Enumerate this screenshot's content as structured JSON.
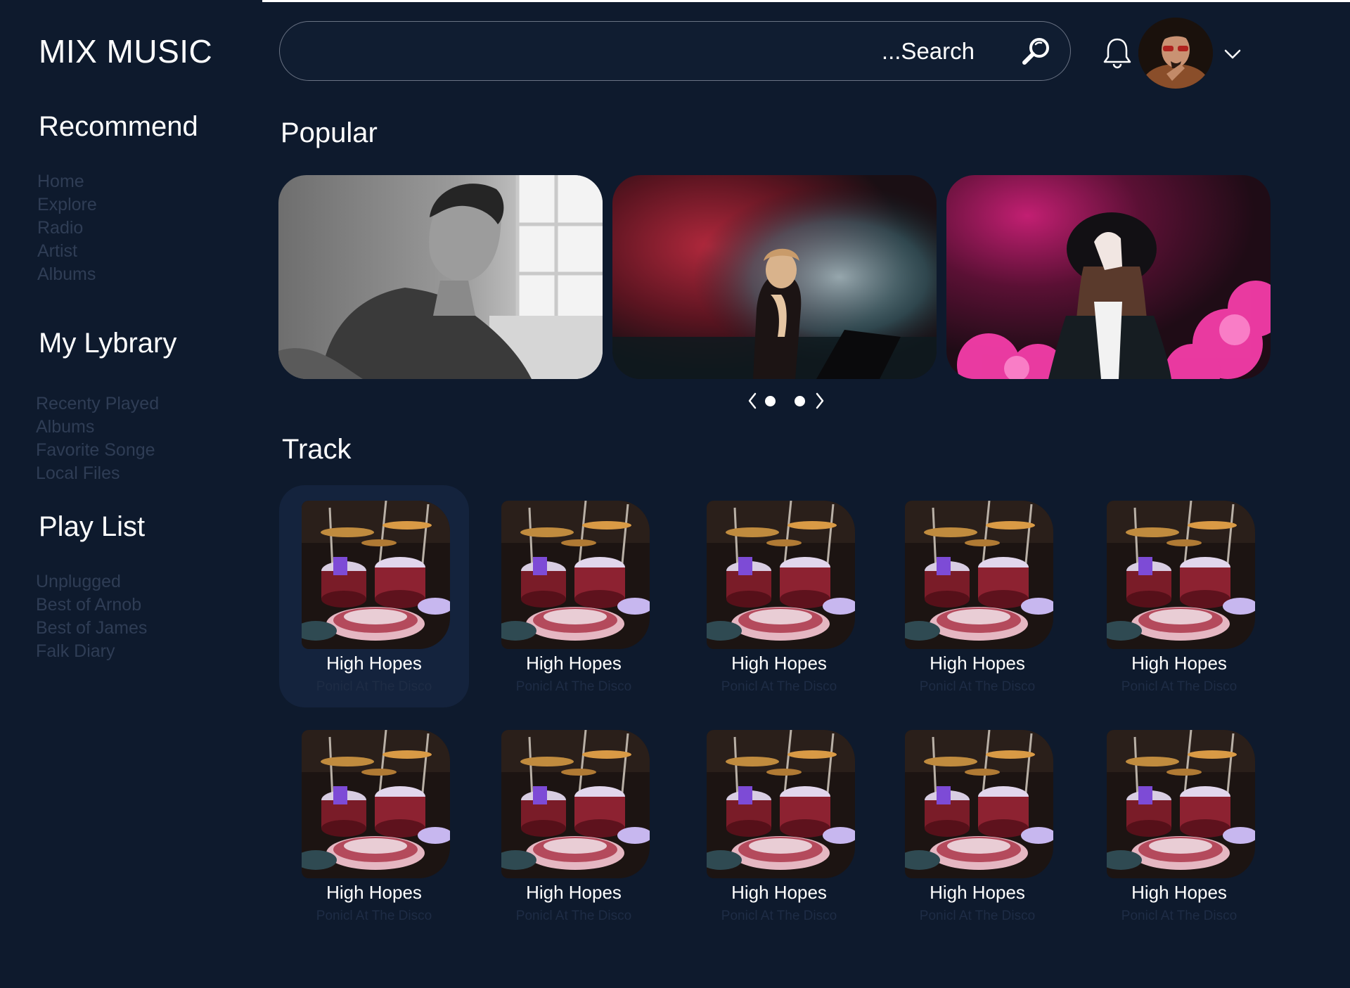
{
  "app": {
    "brand": "MIX MUSIC"
  },
  "sidebar": {
    "recommend": {
      "title": "Recommend",
      "items": [
        "Home",
        "Explore",
        "Radio",
        "Artist",
        "Albums"
      ]
    },
    "library": {
      "title": "My Lybrary",
      "items": [
        "Recenty Played",
        "Albums",
        "Favorite Songe",
        "Local Files"
      ]
    },
    "playlist": {
      "title": "Play List",
      "items": [
        "Unplugged",
        "Best of Arnob",
        "Best of James",
        "Falk Diary"
      ]
    }
  },
  "header": {
    "search_placeholder": "...Search",
    "icons": [
      "search-icon",
      "bell-icon",
      "chevron-down-icon"
    ]
  },
  "popular": {
    "title": "Popular",
    "cards": [
      {
        "name": "popular-card-1",
        "scene": "man-by-window-monochrome"
      },
      {
        "name": "popular-card-2",
        "scene": "dj-red-smoke"
      },
      {
        "name": "popular-card-3",
        "scene": "woman-hat-pink-smoke"
      }
    ],
    "carousel": {
      "active_index": 0,
      "dots": 2
    }
  },
  "tracks": {
    "title": "Track",
    "items": [
      {
        "title": "High Hopes",
        "artist": "Ponicl At The Disco",
        "active": true
      },
      {
        "title": "High Hopes",
        "artist": "Ponicl At The Disco"
      },
      {
        "title": "High Hopes",
        "artist": "Ponicl At The Disco"
      },
      {
        "title": "High Hopes",
        "artist": "Ponicl At The Disco"
      },
      {
        "title": "High Hopes",
        "artist": "Ponicl At The Disco"
      },
      {
        "title": "High Hopes",
        "artist": "Ponicl At The Disco"
      },
      {
        "title": "High Hopes",
        "artist": "Ponicl At The Disco"
      },
      {
        "title": "High Hopes",
        "artist": "Ponicl At The Disco"
      },
      {
        "title": "High Hopes",
        "artist": "Ponicl At The Disco"
      },
      {
        "title": "High Hopes",
        "artist": "Ponicl At The Disco"
      }
    ]
  },
  "colors": {
    "background": "#0e1a2d",
    "nav_muted": "#2f3d55",
    "artist_muted": "#1e2c45",
    "active_card": "#14233d",
    "text": "#ffffff"
  }
}
